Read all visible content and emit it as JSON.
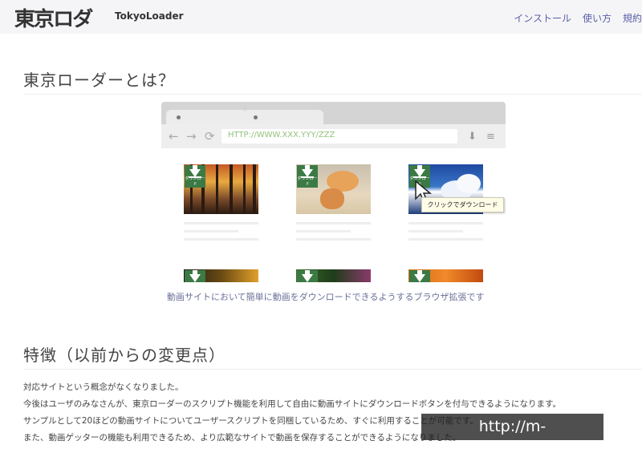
{
  "header": {
    "logo_kanji": "東京ロダ",
    "brand": "TokyoLoader",
    "nav": [
      "インストール",
      "使い方",
      "規約"
    ]
  },
  "section1": {
    "title": "東京ローダーとは？",
    "browser": {
      "url": "HTTP://WWW.XXX.YYY/ZZZ",
      "download_caption": "ダウンロード",
      "tooltip": "クリックでダウンロード"
    },
    "caption": "動画サイトにおいて簡単に動画をダウンロードできるようするブラウザ拡張です"
  },
  "section2": {
    "title": "特徴（以前からの変更点）",
    "lines": [
      "対応サイトという概念がなくなりました。",
      "今後はユーザのみなさんが、東京ローダーのスクリプト機能を利用して自由に動画サイトにダウンロードボタンを付与できるようになります。",
      "サンプルとして20ほどの動画サイトについてユーザースクリプトを同梱しているため、すぐに利用することが可能です。",
      "また、動画ゲッターの機能も利用できるため、より広範なサイトで動画を保存することができるようになりました。"
    ]
  },
  "watermark": "http://m-nes.tistory.com",
  "colors": {
    "accent_nav": "#5a5fa8",
    "download_green": "#3b7a44",
    "url_green": "#93c27b"
  }
}
